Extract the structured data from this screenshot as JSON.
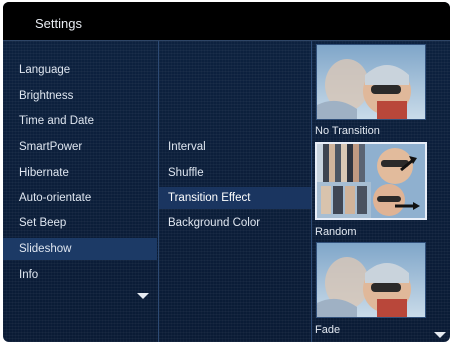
{
  "header": {
    "title": "Settings"
  },
  "settings_menu": {
    "items": [
      {
        "label": "Language"
      },
      {
        "label": "Brightness"
      },
      {
        "label": "Time and Date"
      },
      {
        "label": "SmartPower"
      },
      {
        "label": "Hibernate"
      },
      {
        "label": "Auto-orientate"
      },
      {
        "label": "Set Beep"
      },
      {
        "label": "Slideshow"
      },
      {
        "label": "Info"
      }
    ],
    "selected": "Slideshow",
    "more_icon": "chevron-down-icon"
  },
  "slideshow_menu": {
    "items": [
      {
        "label": "Interval"
      },
      {
        "label": "Shuffle"
      },
      {
        "label": "Transition Effect"
      },
      {
        "label": "Background Color"
      }
    ],
    "selected": "Transition Effect"
  },
  "transition_options": {
    "items": [
      {
        "label": "No Transition"
      },
      {
        "label": "Random"
      },
      {
        "label": "Fade"
      }
    ],
    "selected": "Random",
    "more_icon": "chevron-down-icon"
  },
  "colors": {
    "background": "#0a1b35",
    "title_bar": "#000000",
    "highlight": "#1c3a66",
    "text": "#dfe6f0"
  }
}
